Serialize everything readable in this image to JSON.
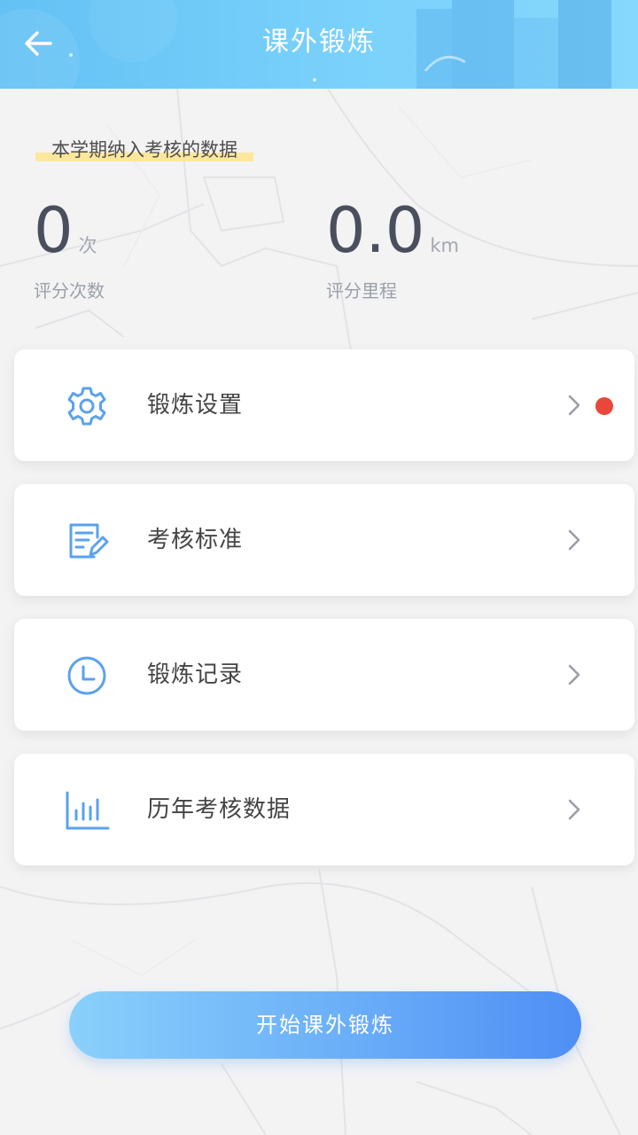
{
  "header": {
    "title": "课外锻炼",
    "back_icon": "arrow-left-icon"
  },
  "summary": {
    "period_label": "本学期纳入考核的数据",
    "count": {
      "value": "0",
      "unit": "次",
      "label": "评分次数"
    },
    "distance": {
      "value": "0.0",
      "unit": "km",
      "label": "评分里程"
    }
  },
  "menu": {
    "items": [
      {
        "label": "锻炼设置",
        "icon": "gear-icon",
        "has_badge": true
      },
      {
        "label": "考核标准",
        "icon": "document-edit-icon",
        "has_badge": false
      },
      {
        "label": "锻炼记录",
        "icon": "clock-icon",
        "has_badge": false
      },
      {
        "label": "历年考核数据",
        "icon": "bar-chart-icon",
        "has_badge": false
      }
    ]
  },
  "actions": {
    "start_label": "开始课外锻炼"
  },
  "colors": {
    "header_gradient_start": "#63c1f4",
    "header_gradient_end": "#86d8fd",
    "icon_blue": "#5aa2ee",
    "badge_red": "#e8483c",
    "button_gradient_start": "#8ad0fb",
    "button_gradient_end": "#4f8ef5"
  }
}
